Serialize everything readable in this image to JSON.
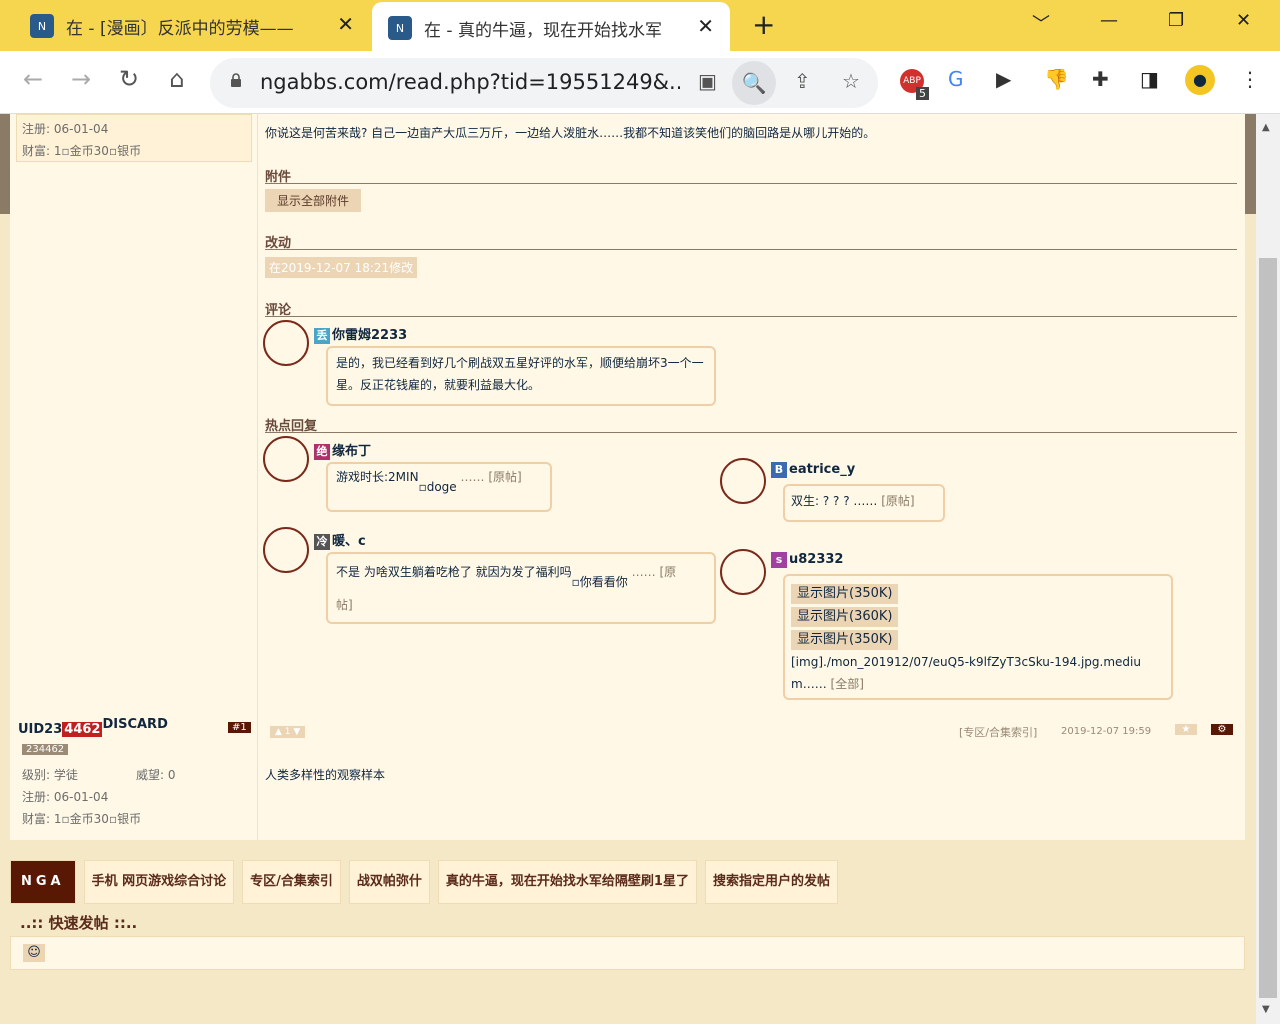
{
  "browser": {
    "tabs": [
      {
        "title": "在 - [漫画〕反派中的劳模——",
        "close": "✕"
      },
      {
        "title": "在 - 真的牛逼，现在开始找水军",
        "close": "✕"
      }
    ],
    "new_tab": "+",
    "url": "ngabbs.com/read.php?tid=19551249&...",
    "abp_count": "5"
  },
  "post1": {
    "reg": "注册: 06-01-04",
    "wealth_prefix": "财富: 1",
    "gold": "金币",
    "gold_mid": "30",
    "silver": "银币",
    "content": "你说这是何苦来哉? 自己一边亩产大瓜三万斤，一边给人泼脏水……我都不知道该笑他们的脑回路是从哪儿开始的。",
    "attach_head": "附件",
    "attach_btn": "显示全部附件",
    "edit_head": "改动",
    "edit_text": "在2019-12-07 18:21修改",
    "comment_head": "评论",
    "comment": {
      "badge": "丢",
      "name": "你雷姆2233",
      "text": "是的，我已经看到好几个刷战双五星好评的水军，顺便给崩坏3一个一星。反正花钱雇的，就要利益最大化。"
    },
    "hot_head": "热点回复",
    "hot": [
      {
        "badge": "绝",
        "name": "缘布丁",
        "text": "游戏时长:2MIN",
        "img": "doge",
        "more": "……",
        "orig": "[原帖]"
      },
      {
        "badge": "B",
        "name": "eatrice_y",
        "text": "双生: ? ? ? ……",
        "orig": "[原帖]"
      },
      {
        "badge": "冷",
        "name": "暖、c",
        "text": "不是 为啥双生躺着吃枪了 就因为发了福利吗",
        "img": "你看看你",
        "more": "…… [原",
        "orig2": "帖]"
      },
      {
        "badge": "s",
        "name": "u82332",
        "imgs": [
          "显示图片(350K)",
          "显示图片(360K)",
          "显示图片(350K)"
        ],
        "path1": "[img]./mon_201912/07/euQ5-k9lfZyT3cSku-194.jpg.mediu",
        "path2": "m……",
        "all": "[全部]"
      }
    ]
  },
  "post2": {
    "uid_a": "UID23",
    "uid_b": "4462",
    "discard": "DISCARD",
    "floor": "#1",
    "uidnum": "234462",
    "level": "级别: 学徒",
    "fame": "威望: 0",
    "reg": "注册: 06-01-04",
    "wealth_prefix": "财富: 1",
    "gold": "金币",
    "gold_mid": "30",
    "silver": "银币",
    "vote": "1",
    "index": "[专区/合集索引]",
    "date": "2019-12-07 19:59",
    "content": "人类多样性的观察样本"
  },
  "breadcrumb": [
    "NGA",
    "手机 网页游戏综合讨论",
    "专区/合集索引",
    "战双帕弥什",
    "真的牛逼，现在开始找水军给隔壁刷1星了",
    "搜索指定用户的发帖"
  ],
  "quick_post": "..:: 快速发帖 ::..",
  "emoji_icon": "☺"
}
